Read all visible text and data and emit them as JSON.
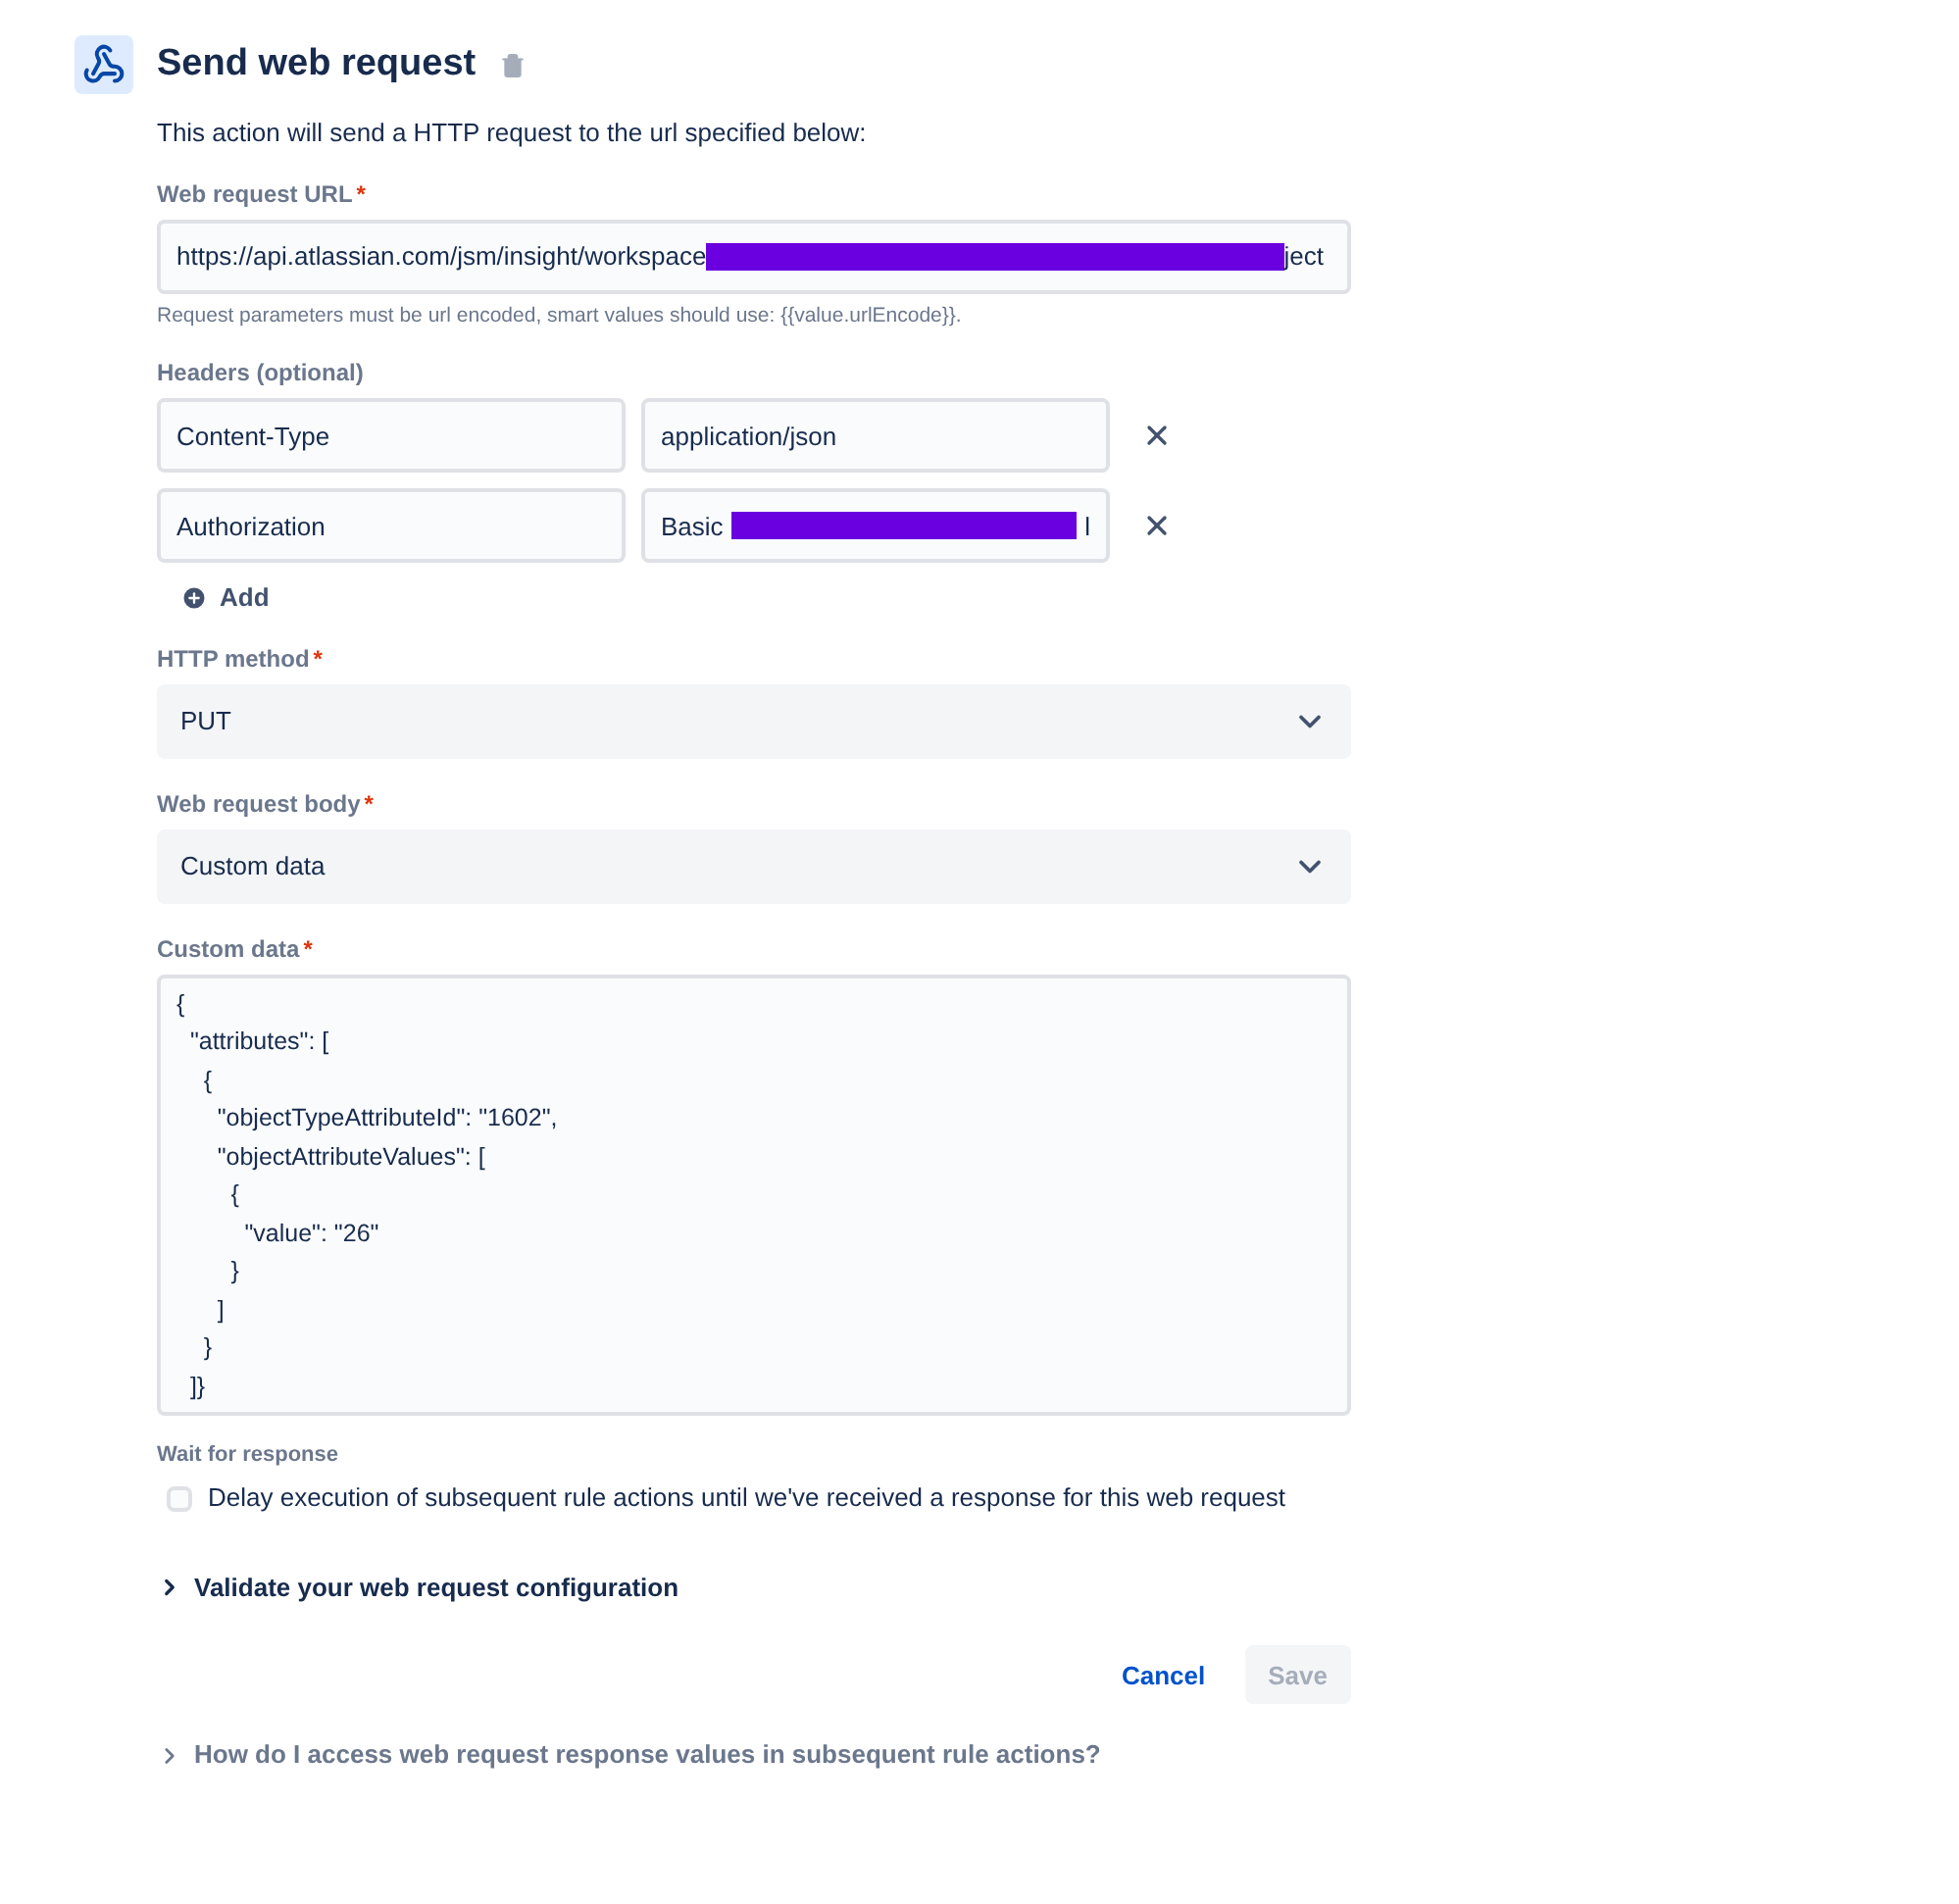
{
  "header": {
    "title": "Send web request"
  },
  "description": "This action will send a HTTP request to the url specified below:",
  "url_field": {
    "label": "Web request URL",
    "required_mark": "*",
    "value": "https://api.atlassian.com/jsm/insight/workspace",
    "redacted": true,
    "tail": "ject",
    "help": "Request parameters must be url encoded, smart values should use: {{value.urlEncode}}."
  },
  "headers": {
    "label": "Headers (optional)",
    "rows": [
      {
        "name": "Content-Type",
        "value": "application/json",
        "redacted": false,
        "tail": ""
      },
      {
        "name": "Authorization",
        "value": "Basic",
        "redacted": true,
        "tail": "l"
      }
    ],
    "add_label": "Add"
  },
  "method": {
    "label": "HTTP method",
    "required_mark": "*",
    "value": "PUT"
  },
  "body": {
    "label": "Web request body",
    "required_mark": "*",
    "value": "Custom data"
  },
  "custom_data": {
    "label": "Custom data",
    "required_mark": "*",
    "value": "{\n  \"attributes\": [\n    {\n      \"objectTypeAttributeId\": \"1602\",\n      \"objectAttributeValues\": [\n        {\n          \"value\": \"26\"\n        }\n      ]\n    }\n  ]}"
  },
  "wait": {
    "label": "Wait for response",
    "checkbox_label": "Delay execution of subsequent rule actions until we've received a response for this web request",
    "checked": false
  },
  "validate": {
    "label": "Validate your web request configuration",
    "expanded": false
  },
  "actions": {
    "cancel": "Cancel",
    "save": "Save",
    "save_disabled": true
  },
  "help_toggle": {
    "label": "How do I access web request response values in subsequent rule actions?",
    "expanded": false
  }
}
